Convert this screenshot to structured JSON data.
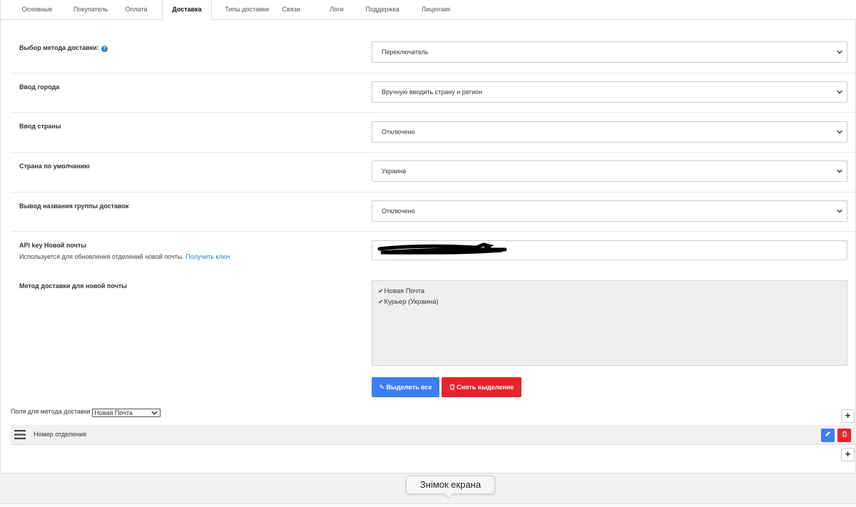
{
  "tabs": [
    {
      "label": "Основные"
    },
    {
      "label": "Покупатель"
    },
    {
      "label": "Оплата"
    },
    {
      "label": "Доставка"
    },
    {
      "label": "Типы доставки"
    },
    {
      "label": "Связи"
    },
    {
      "label": "Логи"
    },
    {
      "label": "Поддержка"
    },
    {
      "label": "Лицензия"
    }
  ],
  "settings": {
    "delivery_method": {
      "label": "Выбор метода доставки:",
      "value": "Переключатель"
    },
    "city_input": {
      "label": "Ввод города",
      "value": "Вручную вводить страну и регион"
    },
    "country_input": {
      "label": "Ввод страны",
      "value": "Отключено"
    },
    "default_country": {
      "label": "Страна по умолчанию",
      "value": "Украина"
    },
    "group_name_output": {
      "label": "Вывод названия группы доставок",
      "value": "Отключено"
    },
    "api_key": {
      "label": "API key Новой почты",
      "help_text": "Используется для обновления отделений новой почты.",
      "link_text": "Получить ключ"
    },
    "np_methods": {
      "label": "Метод доставки для новой почты",
      "options": [
        {
          "label": "Новая Почта"
        },
        {
          "label": "Курьер (Украина)"
        }
      ]
    }
  },
  "buttons": {
    "select_all": "Выделить все",
    "deselect": "Снять выделение"
  },
  "fields": {
    "label": "Поля для метода доставки",
    "method_value": "Новая Почта",
    "rows": [
      {
        "name": "Номер отделения"
      }
    ]
  },
  "tooltip": {
    "text": "Знімок екрана"
  },
  "colors": {
    "accent_blue": "#3b7ff0",
    "danger_red": "#e8242b",
    "link": "#2a7fbf"
  }
}
